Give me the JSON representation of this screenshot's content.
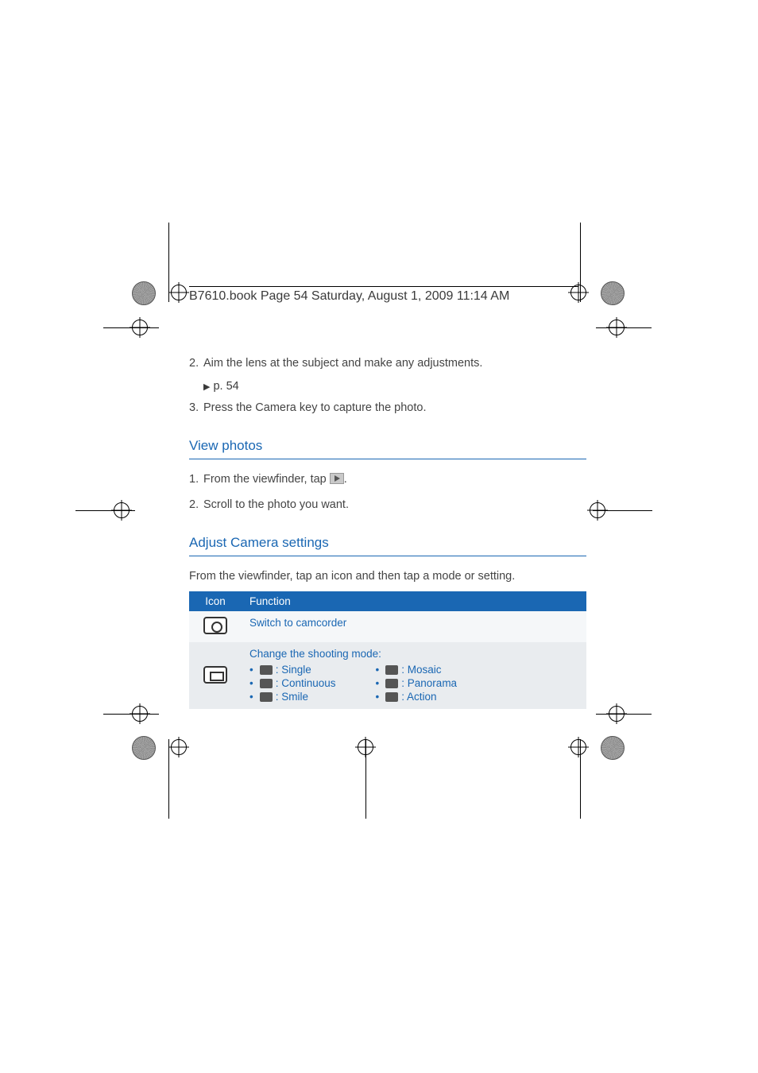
{
  "header": {
    "book_line": "B7610.book  Page 54  Saturday, August 1, 2009  11:14 AM"
  },
  "steps_a": {
    "s2": "Aim the lens at the subject and make any adjustments.",
    "s2_ref": "p. 54",
    "s3": "Press the Camera key to capture the photo."
  },
  "section_view": {
    "title": "View photos",
    "s1_pre": "From the viewfinder, tap ",
    "s1_post": ".",
    "s2": "Scroll to the photo you want."
  },
  "section_adjust": {
    "title": "Adjust Camera settings",
    "intro": "From the viewfinder, tap an icon and then tap a mode or setting."
  },
  "table": {
    "h_icon": "Icon",
    "h_func": "Function",
    "row1": "Switch to camcorder",
    "row2_intro": "Change the shooting mode:",
    "modes_left": [
      {
        "label": ": Single"
      },
      {
        "label": ": Continuous"
      },
      {
        "label": ": Smile"
      }
    ],
    "modes_right": [
      {
        "label": ": Mosaic"
      },
      {
        "label": ": Panorama"
      },
      {
        "label": ": Action"
      }
    ]
  }
}
